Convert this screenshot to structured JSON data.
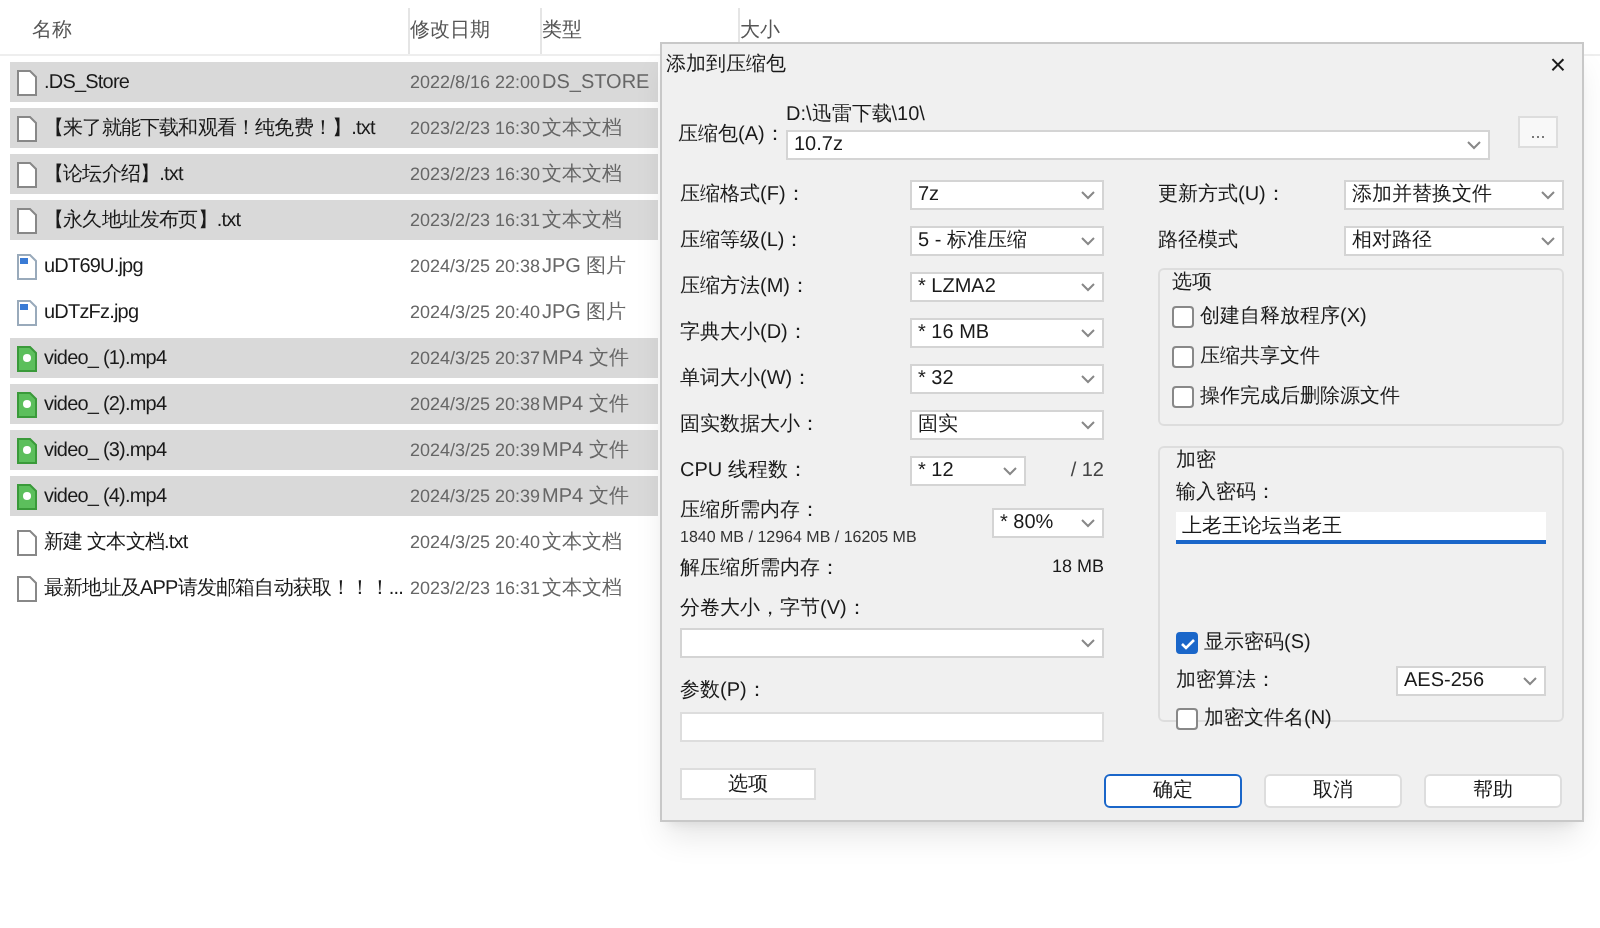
{
  "explorer": {
    "columns": [
      "名称",
      "修改日期",
      "类型",
      "大小"
    ],
    "rows": [
      {
        "kind": "document",
        "name": ".DS_Store",
        "modified": "2022/8/16 22:00",
        "type": "DS_STORE",
        "selected": true
      },
      {
        "kind": "document",
        "name": "【来了就能下载和观看！纯免费！】.txt",
        "modified": "2023/2/23 16:30",
        "type": "文本文档",
        "selected": true
      },
      {
        "kind": "document",
        "name": "【论坛介绍】.txt",
        "modified": "2023/2/23 16:30",
        "type": "文本文档",
        "selected": true
      },
      {
        "kind": "document",
        "name": "【永久地址发布页】.txt",
        "modified": "2023/2/23 16:31",
        "type": "文本文档",
        "selected": true
      },
      {
        "kind": "image",
        "name": "uDT69U.jpg",
        "modified": "2024/3/25 20:38",
        "type": "JPG 图片",
        "selected": false
      },
      {
        "kind": "image",
        "name": "uDTzFz.jpg",
        "modified": "2024/3/25 20:40",
        "type": "JPG 图片",
        "selected": false
      },
      {
        "kind": "video",
        "name": "video_ (1).mp4",
        "modified": "2024/3/25 20:37",
        "type": "MP4 文件",
        "selected": true
      },
      {
        "kind": "video",
        "name": "video_ (2).mp4",
        "modified": "2024/3/25 20:38",
        "type": "MP4 文件",
        "selected": true
      },
      {
        "kind": "video",
        "name": "video_ (3).mp4",
        "modified": "2024/3/25 20:39",
        "type": "MP4 文件",
        "selected": true
      },
      {
        "kind": "video",
        "name": "video_ (4).mp4",
        "modified": "2024/3/25 20:39",
        "type": "MP4 文件",
        "selected": true
      },
      {
        "kind": "document",
        "name": "新建 文本文档.txt",
        "modified": "2024/3/25 20:40",
        "type": "文本文档",
        "selected": false
      },
      {
        "kind": "document",
        "name": "最新地址及APP请发邮箱自动获取！！！...",
        "modified": "2023/2/23 16:31",
        "type": "文本文档",
        "selected": false
      }
    ]
  },
  "dialog": {
    "title": "添加到压缩包",
    "close": "×",
    "archive": {
      "label": "压缩包(A)：",
      "path": "D:\\迅雷下载\\10\\",
      "value": "10.7z",
      "browse": "..."
    },
    "settings": [
      {
        "label": "压缩格式(F)：",
        "value": "7z"
      },
      {
        "label": "压缩等级(L)：",
        "value": "5 - 标准压缩"
      },
      {
        "label": "压缩方法(M)：",
        "value": "* LZMA2"
      },
      {
        "label": "字典大小(D)：",
        "value": "* 16 MB"
      },
      {
        "label": "单词大小(W)：",
        "value": "* 32"
      },
      {
        "label": "固实数据大小：",
        "value": "固实"
      }
    ],
    "cpu": {
      "label": "CPU 线程数：",
      "value": "* 12",
      "total": "/ 12"
    },
    "memory": {
      "label": "压缩所需内存：",
      "detail": "1840 MB / 12964 MB / 16205 MB",
      "value": "* 80%"
    },
    "decompress_memory": {
      "label": "解压缩所需内存：",
      "value": "18 MB"
    },
    "volume": {
      "label": "分卷大小，字节(V)："
    },
    "parameters": {
      "label": "参数(P)："
    },
    "options_button": "选项",
    "update_mode": {
      "label": "更新方式(U)：",
      "value": "添加并替换文件"
    },
    "path_mode": {
      "label": "路径模式",
      "value": "相对路径"
    },
    "options_group": {
      "title": "选项",
      "items": [
        {
          "label": "创建自释放程序(X)",
          "checked": false
        },
        {
          "label": "压缩共享文件",
          "checked": false
        },
        {
          "label": "操作完成后删除源文件",
          "checked": false
        }
      ]
    },
    "encryption": {
      "title": "加密",
      "password_label": "输入密码：",
      "password": "上老王论坛当老王",
      "show_password": {
        "label": "显示密码(S)",
        "checked": true
      },
      "method": {
        "label": "加密算法：",
        "value": "AES-256"
      },
      "encrypt_names": {
        "label": "加密文件名(N)",
        "checked": false
      }
    },
    "buttons": [
      {
        "label": "确定",
        "default": true
      },
      {
        "label": "取消",
        "default": false
      },
      {
        "label": "帮助",
        "default": false
      }
    ]
  }
}
